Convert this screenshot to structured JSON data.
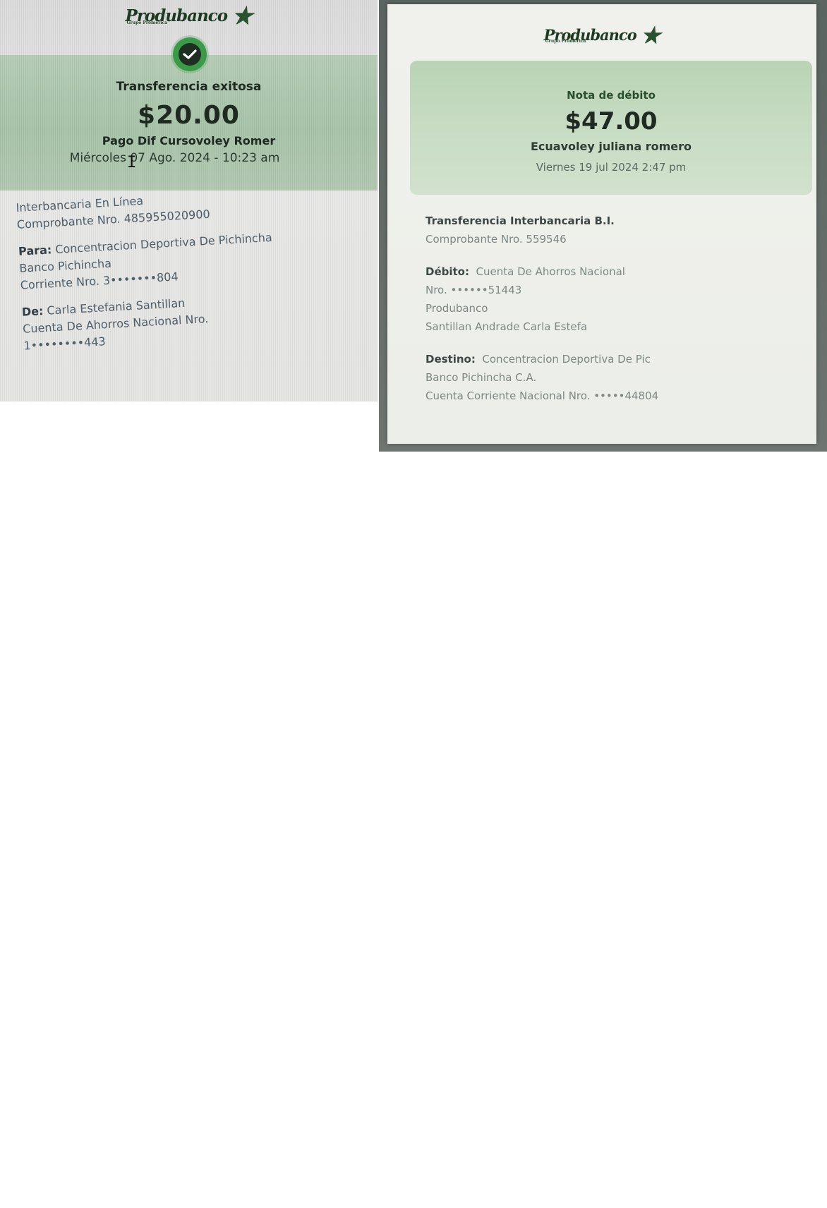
{
  "left_receipt": {
    "brand": "Produbanco",
    "brand_sub": "Grupo Promerica",
    "status": "Transferencia exitosa",
    "amount": "$20.00",
    "concept": "Pago Dif Cursovoley Romer",
    "date": "Miércoles 07 Ago. 2024 - 10:23 am",
    "type": "Interbancaria En Línea",
    "voucher": "Comprobante Nro. 485955020900",
    "to_label": "Para:",
    "to_name": "Concentracion Deportiva De Pichincha",
    "to_bank": "Banco Pichincha",
    "to_account": "Corriente Nro. 3•••••••804",
    "from_label": "De:",
    "from_name": "Carla Estefania Santillan",
    "from_account_type": "Cuenta De Ahorros Nacional Nro.",
    "from_account": "1••••••••443"
  },
  "right_receipt": {
    "brand": "Produbanco",
    "brand_sub": "Grupo Promerica",
    "status": "Nota de débito",
    "amount": "$47.00",
    "concept": "Ecuavoley juliana romero",
    "date": "Viernes 19 jul 2024 2:47 pm",
    "type": "Transferencia Interbancaria B.I.",
    "voucher": "Comprobante Nro.  559546",
    "debit_label": "Débito:",
    "debit_account_type": "Cuenta De Ahorros Nacional",
    "debit_account": "Nro. ••••••51443",
    "debit_bank": "Produbanco",
    "debit_holder": "Santillan Andrade Carla Estefa",
    "dest_label": "Destino:",
    "dest_name": "Concentracion Deportiva De Pic",
    "dest_bank": "Banco Pichincha C.A.",
    "dest_account": "Cuenta Corriente Nacional Nro. •••••44804"
  },
  "colors": {
    "band_green": "#a9c5ab",
    "success_green": "#3b9a47",
    "brand_dark": "#1d3b23"
  },
  "icons": [
    "star-logo-icon",
    "check-circle-icon",
    "text-cursor-icon"
  ]
}
